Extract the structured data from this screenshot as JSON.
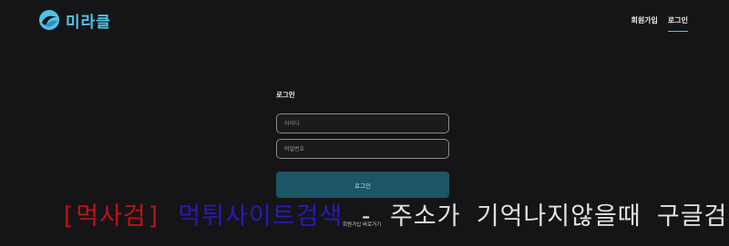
{
  "brand": {
    "name": "미라클",
    "accent": "#4fc3e8"
  },
  "nav": {
    "items": [
      {
        "label": "회원가입",
        "active": false
      },
      {
        "label": "로그인",
        "active": true
      }
    ]
  },
  "login": {
    "title": "로그인",
    "id_placeholder": "아이디",
    "pw_placeholder": "비밀번호",
    "submit_label": "로그인",
    "join_link": "회원가입 바로가기"
  },
  "banner": {
    "part1": "[먹사검]",
    "part2": "먹튀사이트검색",
    "part3": "- 주소가 기억나지않을때 구글검색",
    "colors": {
      "part1": "#c0111a",
      "part2": "#2a18b8",
      "part3": "#e2e2e2"
    }
  }
}
